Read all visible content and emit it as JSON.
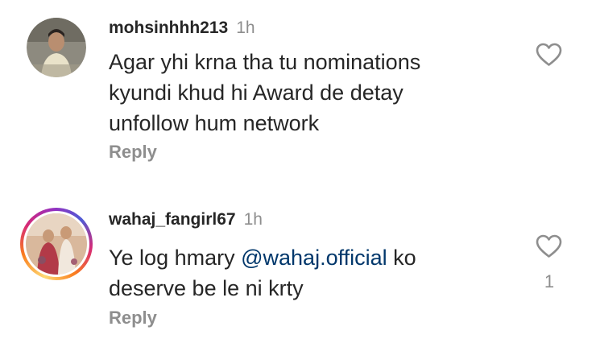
{
  "comments": [
    {
      "username": "mohsinhhh213",
      "time": "1h",
      "text_lines": [
        "Agar yhi krna tha tu nominations",
        "kyundi khud hi Award de detay",
        "unfollow hum network"
      ],
      "reply_label": "Reply",
      "like_count": "",
      "avatar_icon": "user-photo-avatar",
      "has_story_ring": false
    },
    {
      "username": "wahaj_fangirl67",
      "time": "1h",
      "text_before_mention": "Ye log hmary ",
      "mention": "@wahaj.official",
      "text_after_mention": " ko",
      "text_line_2": "deserve be le ni krty",
      "reply_label": "Reply",
      "like_count": "1",
      "avatar_icon": "wedding-photo-avatar",
      "has_story_ring": true
    }
  ],
  "colors": {
    "text": "#262626",
    "muted": "#8e8e8e",
    "mention": "#00376b",
    "background": "#ffffff"
  }
}
